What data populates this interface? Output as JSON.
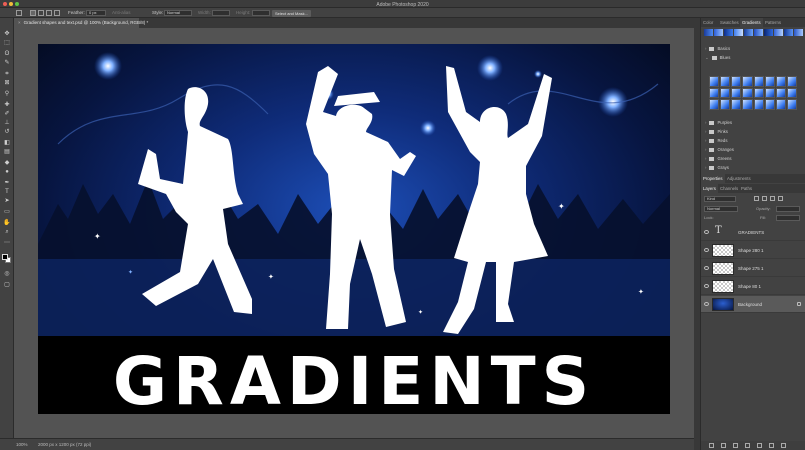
{
  "app": {
    "title": "Adobe Photoshop 2020"
  },
  "options": {
    "feather_label": "Feather:",
    "feather_value": "0 px",
    "antialias_label": "Anti-alias",
    "style_label": "Style:",
    "style_value": "Normal",
    "width_label": "Width:",
    "height_label": "Height:",
    "select_mask_label": "Select and Mask..."
  },
  "document": {
    "tab_title": "Gradient shapes and text.psd @ 100% (Background, RGB/8) *",
    "close_glyph": "×",
    "headline": "GRADIENTS"
  },
  "status": {
    "zoom": "100%",
    "info": "2000 px x 1200 px (72 ppi)"
  },
  "panels": {
    "top_tabs": [
      "Color",
      "Swatches",
      "Gradients",
      "Patterns"
    ],
    "top_active": 2,
    "gradient_folders": [
      {
        "name": "Basics",
        "expanded": false
      },
      {
        "name": "Blues",
        "expanded": true
      },
      {
        "name": "Purples",
        "expanded": false
      },
      {
        "name": "Pinks",
        "expanded": false
      },
      {
        "name": "Reds",
        "expanded": false
      },
      {
        "name": "Oranges",
        "expanded": false
      },
      {
        "name": "Greens",
        "expanded": false
      },
      {
        "name": "Grays",
        "expanded": false
      },
      {
        "name": "Cloud",
        "expanded": false
      }
    ],
    "mid_tabs": [
      "Properties",
      "Adjustments"
    ],
    "mid_active": 0,
    "layer_tabs": [
      "Layers",
      "Channels",
      "Paths"
    ],
    "layer_active": 0,
    "filter_value": "Kind",
    "blend_mode": "Normal",
    "opacity_label": "Opacity:",
    "lock_label": "Lock:",
    "fill_label": "Fill:",
    "layers": [
      {
        "name": "GRADIENTS",
        "type": "text",
        "selected": false
      },
      {
        "name": "Shape 280 1",
        "type": "shape",
        "selected": false
      },
      {
        "name": "Shape 275 1",
        "type": "shape",
        "selected": false
      },
      {
        "name": "Shape 80 1",
        "type": "shape",
        "selected": false
      },
      {
        "name": "Background",
        "type": "background",
        "selected": true
      }
    ]
  },
  "icons": {
    "toolbar": [
      "move-icon",
      "marquee-icon",
      "lasso-icon",
      "quick-select-icon",
      "crop-icon",
      "frame-icon",
      "eyedropper-icon",
      "healing-icon",
      "brush-icon",
      "clone-stamp-icon",
      "history-brush-icon",
      "eraser-icon",
      "gradient-icon",
      "blur-icon",
      "dodge-icon",
      "pen-icon",
      "type-icon",
      "path-select-icon",
      "rectangle-icon",
      "hand-icon",
      "zoom-icon",
      "more-tools-icon"
    ]
  },
  "colors": {
    "canvas_bg": "#0f2c7a",
    "accent_blue": "#2a63e6",
    "text_white": "#ffffff"
  }
}
